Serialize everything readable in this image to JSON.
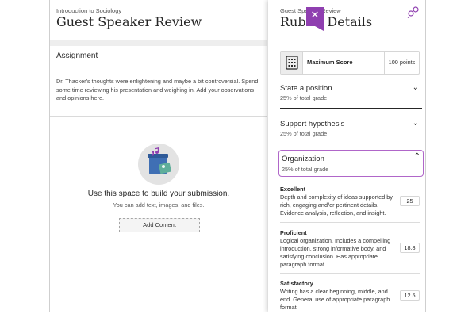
{
  "left": {
    "course": "Introduction to Sociology",
    "title": "Guest Speaker Review",
    "assignment_heading": "Assignment",
    "assignment_text": "Dr. Thacker's thoughts were enlightening and maybe a bit controversial. Spend some time reviewing his presentation and weighing in. Add your observations and opinions here.",
    "build_title": "Use this space to build your submission.",
    "build_subtitle": "You can add text, images, and files.",
    "add_content_label": "Add Content"
  },
  "close_icon": "close-icon",
  "right": {
    "crumb": "Guest Speaker Review",
    "title": "Rubric Details",
    "max_score": {
      "label": "Maximum Score",
      "value": "100 points",
      "icon": "rubric-grid-icon"
    },
    "criteria": [
      {
        "name": "State a position",
        "percent": "25% of total grade",
        "chevron": "chevron-down-icon"
      },
      {
        "name": "Support hypothesis",
        "percent": "25% of total grade",
        "chevron": "chevron-down-icon"
      },
      {
        "name": "Organization",
        "percent": "25% of total grade",
        "chevron": "chevron-up-icon"
      }
    ],
    "levels": [
      {
        "name": "Excellent",
        "description": "Depth and complexity of ideas supported by rich, engaging and/or pertinent details. Evidence analysis, reflection, and insight.",
        "points": "25"
      },
      {
        "name": "Proficient",
        "description": "Logical organization. Includes a compelling introduction, strong informative body, and satisfying conclusion. Has appropriate paragraph format.",
        "points": "18.8"
      },
      {
        "name": "Satisfactory",
        "description": "Writing has a clear beginning, middle, and end. General use of appropriate paragraph format.",
        "points": "12.5"
      }
    ]
  },
  "colors": {
    "accent": "#8f3fb0",
    "focus_border": "#b066c9"
  }
}
